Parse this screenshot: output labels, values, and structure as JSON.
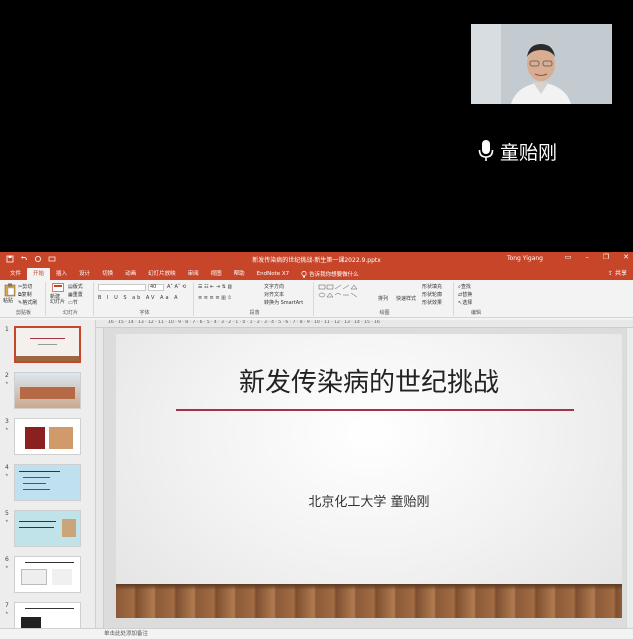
{
  "meeting": {
    "speaker_name": "童贻刚"
  },
  "ppt": {
    "doc_title": "新发传染病的世纪挑战-新生第一课2022.9.pptx",
    "user": "Tong Yigang",
    "share": "共享",
    "tell_me": "告诉我你想要做什么",
    "tabs": [
      "文件",
      "开始",
      "插入",
      "设计",
      "切换",
      "动画",
      "幻灯片放映",
      "审阅",
      "视图",
      "帮助",
      "EndNote X7"
    ],
    "active_tab": "开始",
    "ribbon": {
      "paste": "粘贴",
      "cut": "剪切",
      "copy": "复制",
      "format_painter": "格式刷",
      "new_slide": "新建\n幻灯片",
      "layout": "版式",
      "reset": "重置",
      "section": "节",
      "font_size": "40",
      "text_direction": "文字方向",
      "align_text": "对齐文本",
      "smartart": "转换为 SmartArt",
      "arrange": "排列",
      "quick_styles": "快速样式",
      "shape_fill": "形状填充",
      "shape_outline": "形状轮廓",
      "shape_effects": "形状效果",
      "find": "查找",
      "replace": "替换",
      "select": "选择",
      "groups": [
        "剪贴板",
        "幻灯片",
        "字体",
        "段落",
        "绘图",
        "编辑"
      ]
    },
    "ruler_text": "16 · 15 · 14 · 13 · 12 · 11 · 10 · 9 · 8 · 7 · 6 · 5 · 4 · 3 · 2 · 1 · 0 · 1 · 2 · 3 · 4 · 5 · 6 · 7 · 8 · 9 · 10 · 11 · 12 · 13 · 14 · 15 · 16",
    "thumbnails": [
      "1",
      "2",
      "3",
      "4",
      "5",
      "6",
      "7"
    ],
    "slide": {
      "title": "新发传染病的世纪挑战",
      "author": "北京化工大学  童贻刚"
    },
    "notes_placeholder": "单击此处添加备注"
  }
}
